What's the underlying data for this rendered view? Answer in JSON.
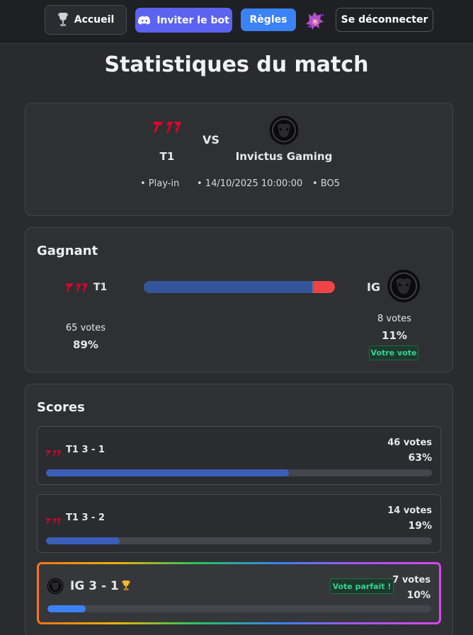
{
  "nav": {
    "home_label": "Accueil",
    "invite_label": "Inviter le bot",
    "rules_label": "Règles",
    "logout_label": "Se déconnecter"
  },
  "page": {
    "title": "Statistiques du match"
  },
  "match": {
    "team1": "T1",
    "vs": "VS",
    "team2": "Invictus Gaming",
    "stage": "• Play-in",
    "datetime": "• 14/10/2025 10:00:00",
    "format": "• BO5"
  },
  "winner": {
    "title": "Gagnant",
    "team1_short": "T1",
    "team2_short": "IG",
    "team1_votes": "65 votes",
    "team1_pct": "89%",
    "team1_fraction": 0.89,
    "team2_votes": "8 votes",
    "team2_pct": "11%",
    "your_vote": "Votre vote"
  },
  "scores": {
    "title": "Scores",
    "items": [
      {
        "label": "T1 3 - 1",
        "votes": "46 votes",
        "pct": "63%",
        "fraction": 0.63,
        "team": "t1"
      },
      {
        "label": "T1 3 - 2",
        "votes": "14 votes",
        "pct": "19%",
        "fraction": 0.19,
        "team": "t1"
      },
      {
        "label": "IG 3 - 1",
        "votes": "7 votes",
        "pct": "10%",
        "fraction": 0.1,
        "team": "ig",
        "badge": "Vote parfait !"
      }
    ]
  },
  "colors": {
    "accent_discord": "#5b63f0",
    "accent_rules": "#3b82f6",
    "t1_red": "#e4002b",
    "bar_blue": "#345599",
    "bar_red": "#ef4444",
    "success_green": "#34d399"
  }
}
